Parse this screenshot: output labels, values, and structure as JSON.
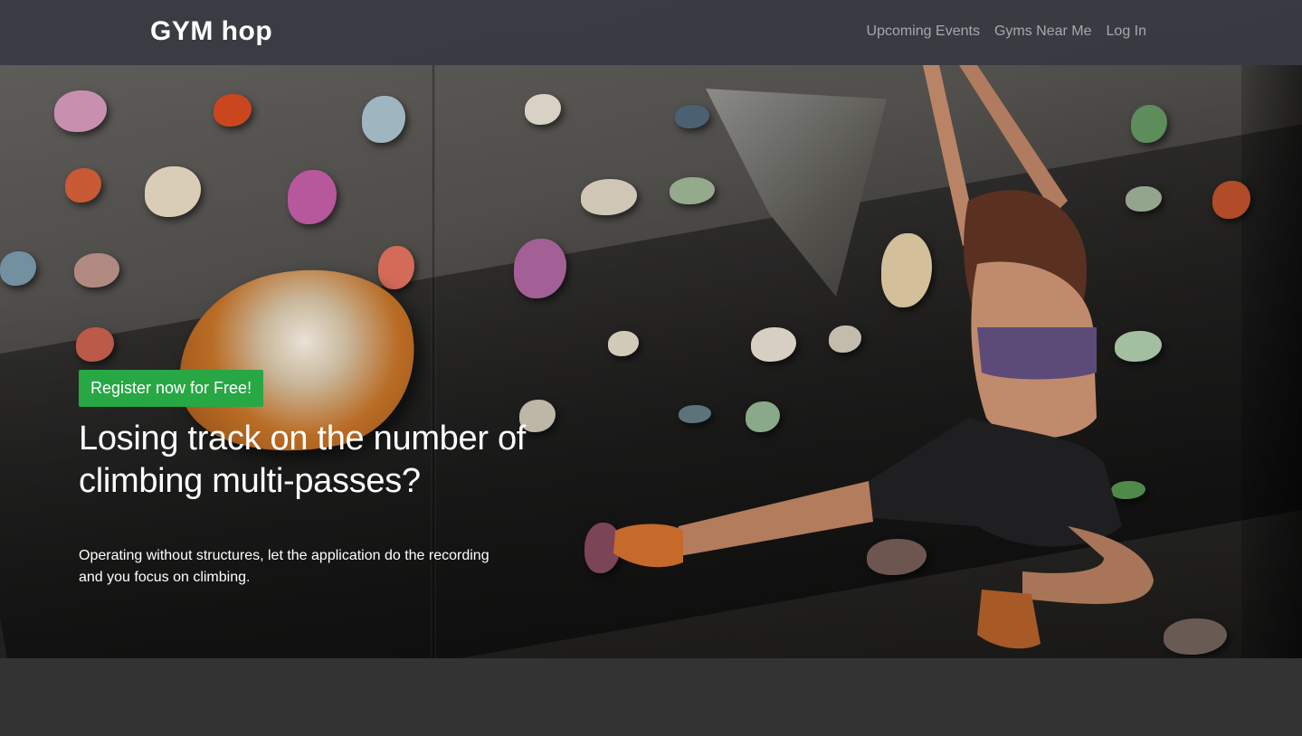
{
  "navbar": {
    "brand": "GYM hop",
    "links": [
      {
        "label": "Upcoming Events"
      },
      {
        "label": "Gyms Near Me"
      },
      {
        "label": "Log In"
      }
    ]
  },
  "hero": {
    "cta_label": "Register now for Free!",
    "headline": "Losing track on the number of climbing multi-passes?",
    "subtext": "Operating without structures, let the application do the recording and you focus on climbing.",
    "background_image": "climbing-wall-photo"
  },
  "colors": {
    "navbar_bg": "#343840",
    "cta_green": "#28a745",
    "page_bg": "#333333",
    "nav_link": "#9a9ca0"
  }
}
